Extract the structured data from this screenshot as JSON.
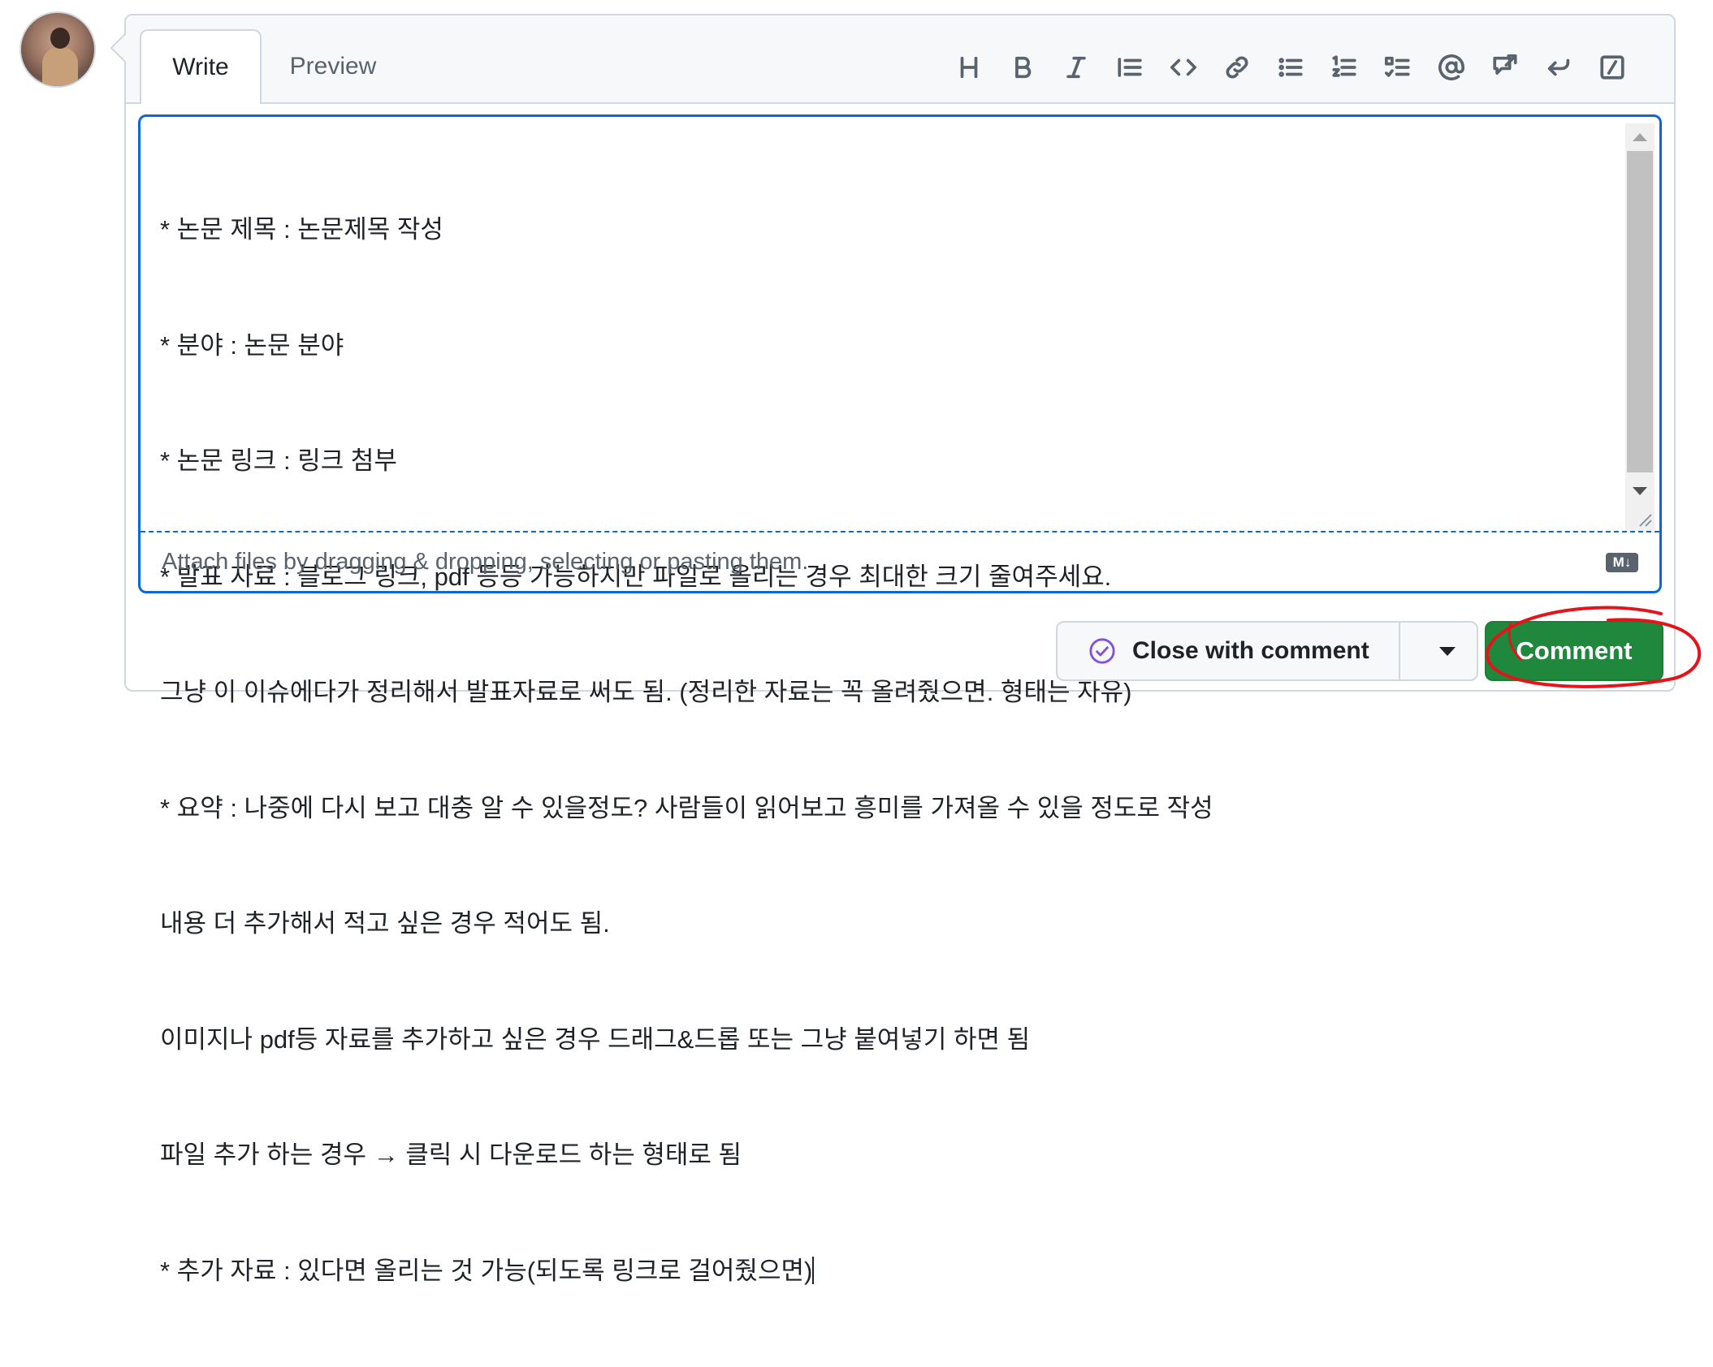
{
  "tabs": {
    "write": "Write",
    "preview": "Preview"
  },
  "toolbar": [
    {
      "name": "heading-icon",
      "glyph": "H"
    },
    {
      "name": "bold-icon",
      "glyph": "B"
    },
    {
      "name": "italic-icon",
      "glyph": "I"
    },
    {
      "name": "quote-icon",
      "glyph": ""
    },
    {
      "name": "code-icon",
      "glyph": ""
    },
    {
      "name": "link-icon",
      "glyph": ""
    },
    {
      "name": "unordered-list-icon",
      "glyph": ""
    },
    {
      "name": "ordered-list-icon",
      "glyph": ""
    },
    {
      "name": "task-list-icon",
      "glyph": ""
    },
    {
      "name": "mention-icon",
      "glyph": "@"
    },
    {
      "name": "cross-reference-icon",
      "glyph": ""
    },
    {
      "name": "reply-icon",
      "glyph": ""
    },
    {
      "name": "slash-commands-icon",
      "glyph": ""
    }
  ],
  "editor": {
    "lines": [
      "* 논문 제목 : 논문제목 작성",
      "* 분야 : 논문 분야",
      "* 논문 링크 : 링크 첨부",
      "* 발표 자료 : 블로그 링크, pdf 등등 가능하지만 파일로 올리는 경우 최대한 크기 줄여주세요.",
      "그냥 이 이슈에다가 정리해서 발표자료로 써도 됨. (정리한 자료는 꼭 올려줬으면. 형태는 자유)",
      "* 요약 : 나중에 다시 보고 대충 알 수 있을정도? 사람들이 읽어보고 흥미를 가져올 수 있을 정도로 작성",
      "내용 더 추가해서 적고 싶은 경우 적어도 됨.",
      "이미지나 pdf등 자료를 추가하고 싶은 경우 드래그&드롭 또는 그냥 붙여넣기 하면 됨",
      "파일 추가 하는 경우 → 클릭 시 다운로드 하는 형태로 됨",
      "* 추가 자료 : 있다면 올리는 것 가능(되도록 링크로 걸어줬으면)"
    ],
    "attach_hint": "Attach files by dragging & dropping, selecting or pasting them.",
    "markdown_badge": "M↓"
  },
  "actions": {
    "close_label": "Close with comment",
    "comment_label": "Comment"
  },
  "colors": {
    "accent_blue": "#0969da",
    "comment_green": "#1f883d",
    "closed_purple": "#8250df",
    "annotation_red": "#e5141b"
  }
}
